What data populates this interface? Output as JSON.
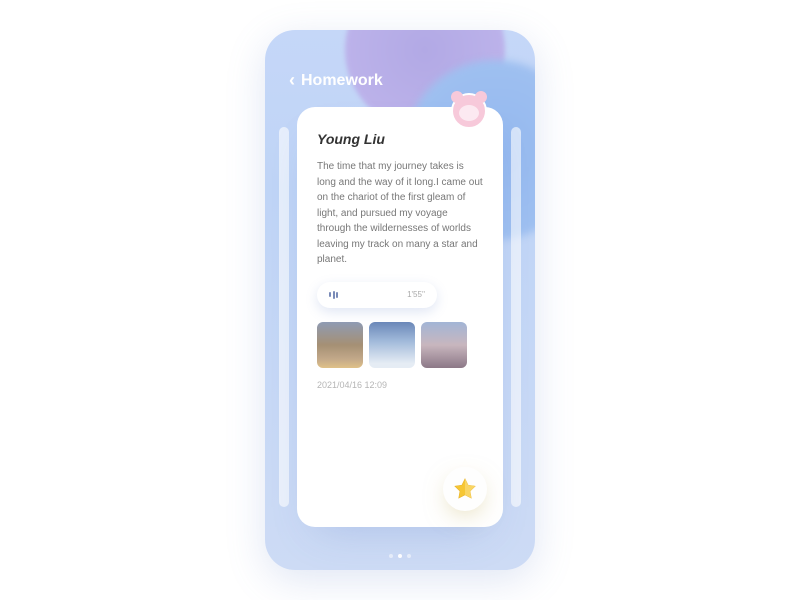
{
  "header": {
    "back_label": "Homework"
  },
  "card": {
    "author": "Young Liu",
    "body": "The time that my journey takes is long and the way of it long.I came out on the chariot of the first gleam of light, and pursued my voyage through the wildernesses of worlds leaving my track on many a star and planet.",
    "audio_duration": "1'55''",
    "timestamp": "2021/04/16 12:09"
  },
  "mascot": {
    "name": "pink-mascot",
    "color": "#f7c9da"
  },
  "star_button": {
    "icon": "star-icon",
    "color": "#f6c634"
  },
  "pagination": {
    "count": 3,
    "active_index": 1
  }
}
